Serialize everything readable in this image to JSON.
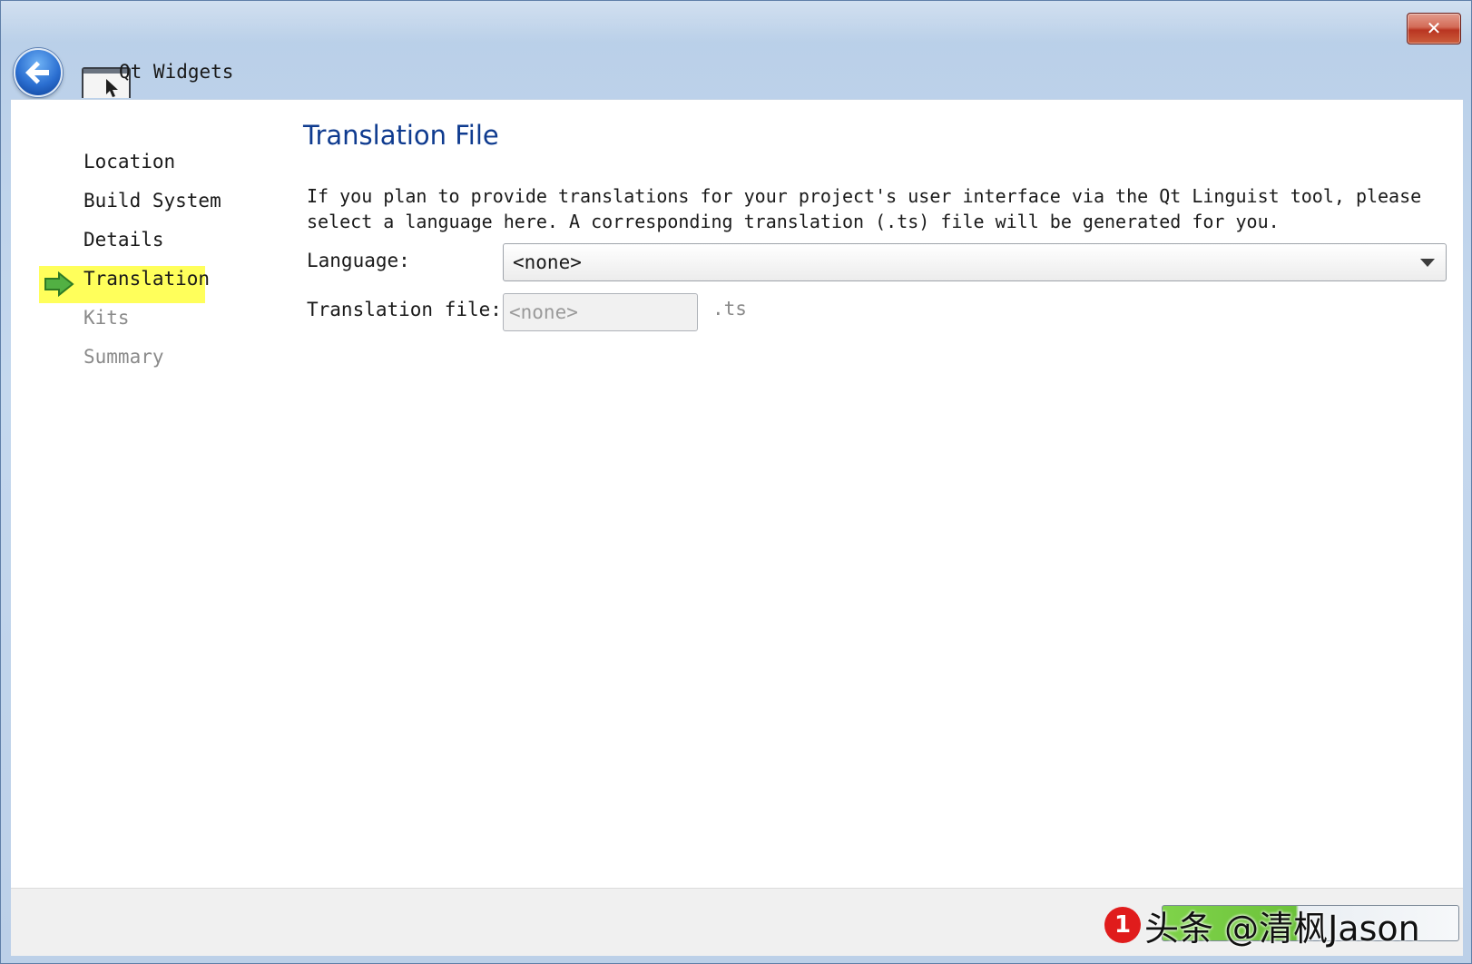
{
  "window": {
    "title": "Qt Widgets",
    "close_label": "✕"
  },
  "steps": [
    {
      "label": "Location",
      "state": "done"
    },
    {
      "label": "Build System",
      "state": "done"
    },
    {
      "label": "Details",
      "state": "done"
    },
    {
      "label": "Translation",
      "state": "current"
    },
    {
      "label": "Kits",
      "state": "pending"
    },
    {
      "label": "Summary",
      "state": "pending"
    }
  ],
  "page": {
    "title": "Translation File",
    "description": "If you plan to provide translations for your project's user interface via the Qt Linguist tool, please select a language here. A corresponding translation (.ts) file will be generated for you.",
    "language_label": "Language:",
    "language_value": "<none>",
    "translation_file_label": "Translation file:",
    "translation_file_value": "<none>",
    "translation_file_suffix": ".ts"
  },
  "watermark": {
    "badge": "1",
    "text": "头条 @清枫Jason"
  },
  "colors": {
    "title_blue": "#0f3b8f",
    "highlight_yellow": "#ffff5b",
    "arrow_green": "#4caf3a",
    "close_red": "#c0392b"
  }
}
